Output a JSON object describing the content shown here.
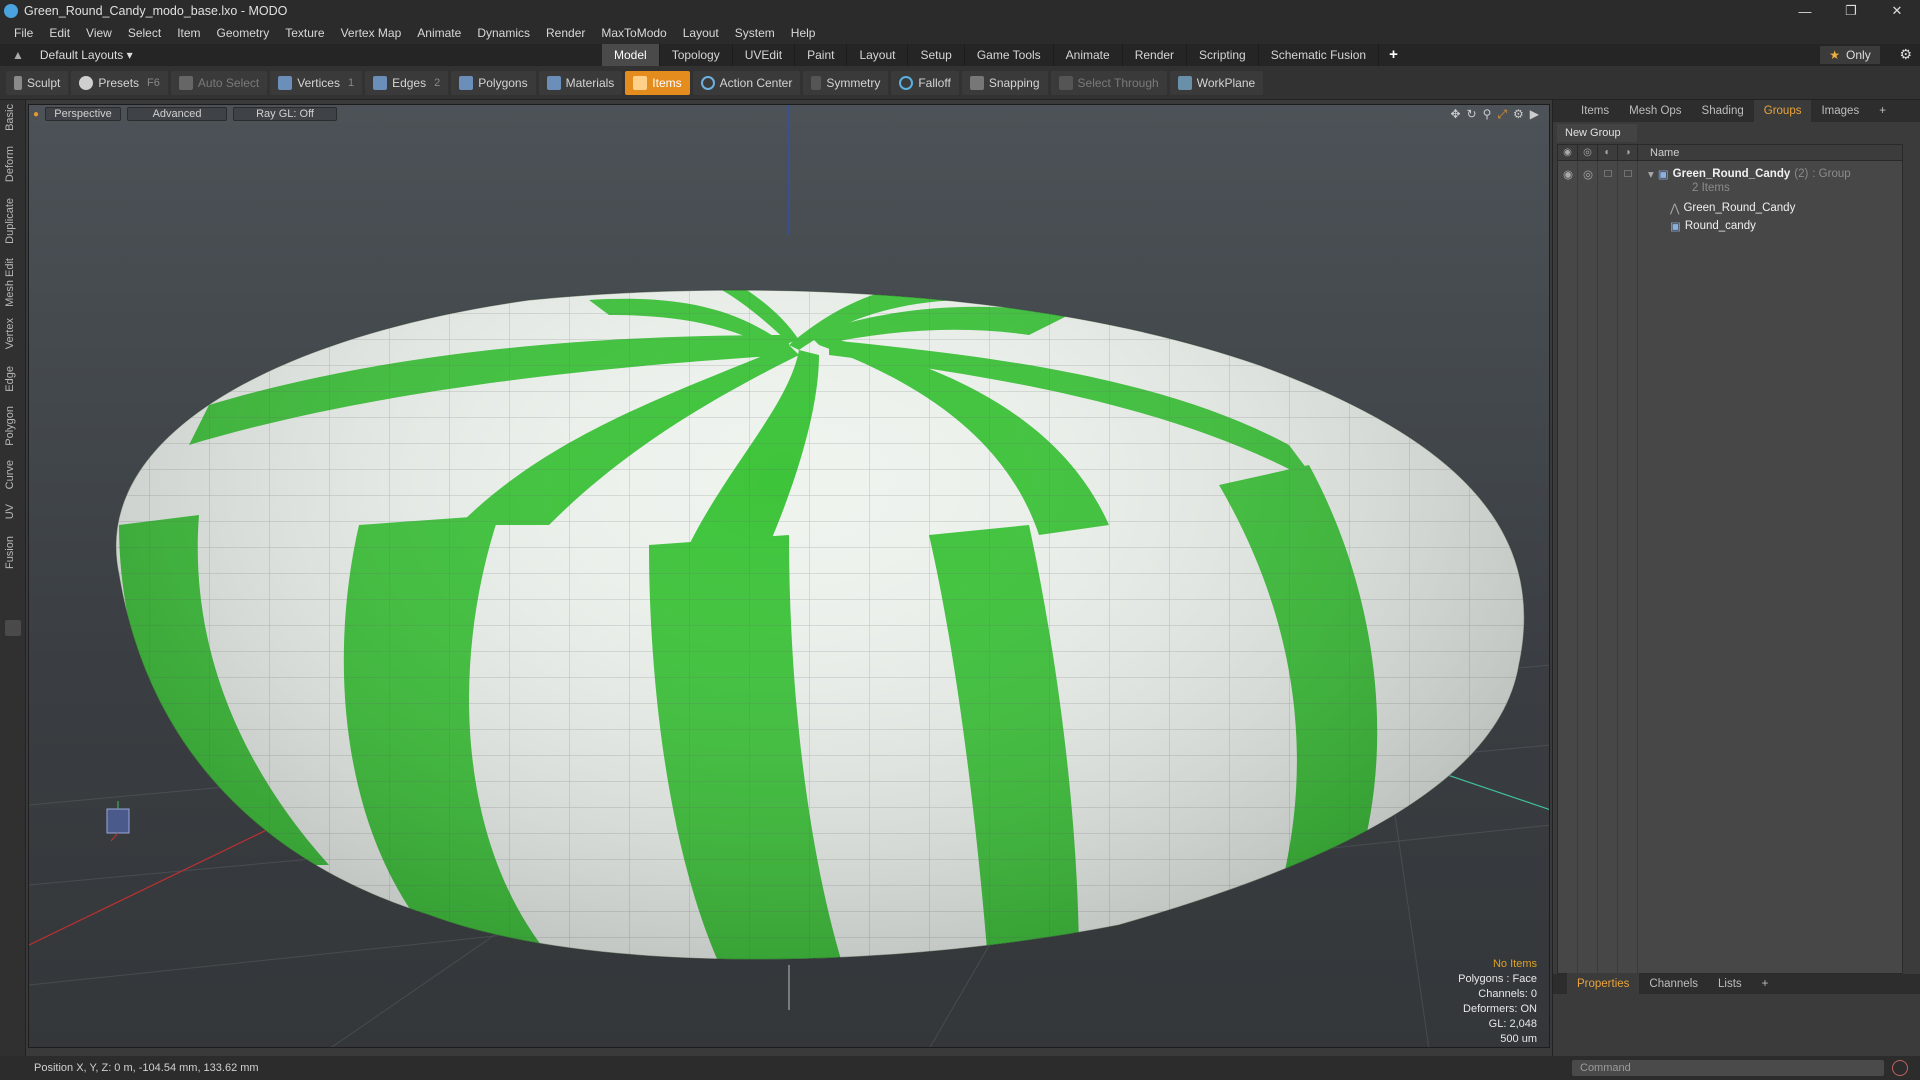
{
  "window": {
    "title": "Green_Round_Candy_modo_base.lxo - MODO"
  },
  "menu": [
    "File",
    "Edit",
    "View",
    "Select",
    "Item",
    "Geometry",
    "Texture",
    "Vertex Map",
    "Animate",
    "Dynamics",
    "Render",
    "MaxToModo",
    "Layout",
    "System",
    "Help"
  ],
  "layouts": {
    "label": "Default Layouts ▾"
  },
  "mode_tabs": [
    "Model",
    "Topology",
    "UVEdit",
    "Paint",
    "Layout",
    "Setup",
    "Game Tools",
    "Animate",
    "Render",
    "Scripting",
    "Schematic Fusion"
  ],
  "mode_plus": "+",
  "only_label": "Only",
  "toolbar": {
    "sculpt": "Sculpt",
    "presets": "Presets",
    "presets_key": "F6",
    "auto_select": "Auto Select",
    "vertices": "Vertices",
    "vertices_key": "1",
    "edges": "Edges",
    "edges_key": "2",
    "polygons": "Polygons",
    "materials": "Materials",
    "items": "Items",
    "action_center": "Action Center",
    "symmetry": "Symmetry",
    "falloff": "Falloff",
    "snapping": "Snapping",
    "select_through": "Select Through",
    "workplane": "WorkPlane"
  },
  "left_tabs": [
    "Basic",
    "Deform",
    "Duplicate",
    "Mesh Edit",
    "Vertex",
    "Edge",
    "Polygon",
    "Curve",
    "UV",
    "Fusion"
  ],
  "viewport": {
    "view": "Perspective",
    "shading": "Advanced",
    "raygl": "Ray GL: Off",
    "info": {
      "selection": "No Items",
      "polygons": "Polygons : Face",
      "channels": "Channels: 0",
      "deformers": "Deformers: ON",
      "gl": "GL: 2,048",
      "scale": "500 um"
    }
  },
  "status": {
    "position": "Position X, Y, Z:  0 m, -104.54 mm, 133.62 mm"
  },
  "right_tabs": [
    "Items",
    "Mesh Ops",
    "Shading",
    "Groups",
    "Images",
    "+"
  ],
  "new_group": "New Group",
  "tree": {
    "name_header": "Name",
    "group": {
      "name": "Green_Round_Candy",
      "count": "(2)",
      "type": ": Group",
      "sub": "2 Items"
    },
    "children": [
      "Green_Round_Candy",
      "Round_candy"
    ]
  },
  "props_tabs": [
    "Properties",
    "Channels",
    "Lists",
    "+"
  ],
  "command": {
    "placeholder": "Command"
  },
  "colors": {
    "accent": "#e58c1e",
    "candy_green": "#3dc43a",
    "candy_white": "#eef3ee"
  }
}
